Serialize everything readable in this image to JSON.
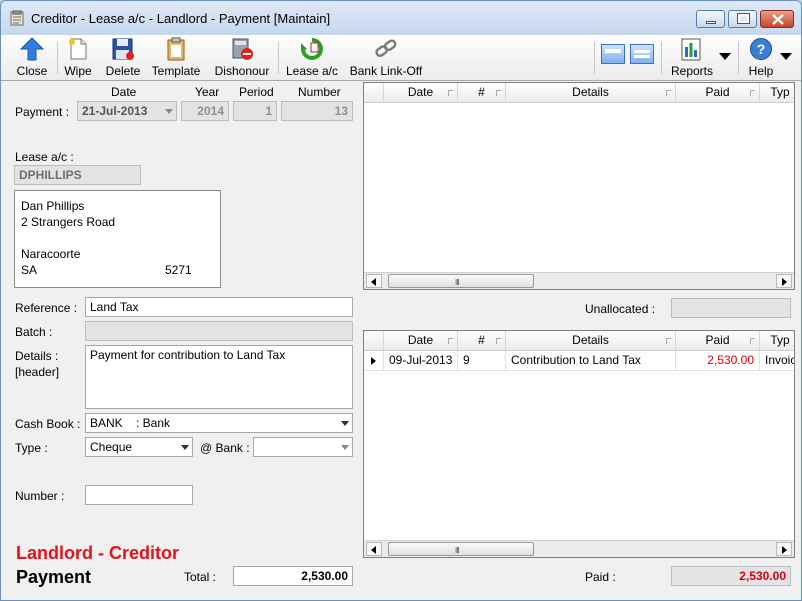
{
  "window": {
    "title": "Creditor - Lease a/c - Landlord - Payment [Maintain]"
  },
  "toolbar": {
    "close_label": "Close",
    "wipe_label": "Wipe",
    "delete_label": "Delete",
    "template_label": "Template",
    "dishonour_label": "Dishonour",
    "lease_label": "Lease a/c",
    "bank_link_label": "Bank Link-Off",
    "reports_label": "Reports",
    "help_label": "Help"
  },
  "payment": {
    "label": "Payment :",
    "date_header": "Date",
    "year_header": "Year",
    "period_header": "Period",
    "number_header": "Number",
    "date": "21-Jul-2013",
    "year": "2014",
    "period": "1",
    "number": "13"
  },
  "lease": {
    "label": "Lease a/c :",
    "code": "DPHILLIPS",
    "address": {
      "name": "Dan Phillips",
      "street": "2 Strangers Road",
      "town": "Naracoorte",
      "state": "SA",
      "postcode": "5271"
    }
  },
  "form": {
    "reference_label": "Reference :",
    "reference": "Land Tax",
    "batch_label": "Batch :",
    "batch": "",
    "details_label": "Details :",
    "details_sublabel": "[header]",
    "details": "Payment for contribution to Land Tax",
    "cashbook_label": "Cash Book :",
    "cashbook_code": "BANK",
    "cashbook_name": ": Bank",
    "type_label": "Type :",
    "type": "Cheque",
    "at_bank_label": "@ Bank :",
    "at_bank": "",
    "number_label": "Number :",
    "number": ""
  },
  "footer": {
    "title_red": "Landlord - Creditor",
    "title_black": "Payment",
    "total_label": "Total :",
    "total": "2,530.00",
    "paid_label": "Paid :",
    "paid": "2,530.00",
    "unallocated_label": "Unallocated :",
    "unallocated": ""
  },
  "top_grid": {
    "columns": [
      "Date",
      "#",
      "Details",
      "Paid",
      "Typ"
    ],
    "rows": []
  },
  "bottom_grid": {
    "columns": [
      "Date",
      "#",
      "Details",
      "Paid",
      "Typ"
    ],
    "rows": [
      {
        "date": "09-Jul-2013",
        "num": "9",
        "details": "Contribution to Land Tax",
        "paid": "2,530.00",
        "type": "Invoic"
      }
    ]
  },
  "colors": {
    "accent_red": "#e8101a",
    "paid_red": "#d8000c"
  }
}
